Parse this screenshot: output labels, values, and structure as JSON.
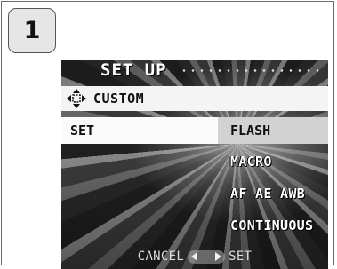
{
  "step": {
    "number": "1"
  },
  "screen": {
    "title": "SET UP",
    "custom_row": {
      "icon": "four-way-arrows-icon",
      "label": "CUSTOM"
    },
    "set_row": {
      "label": "SET",
      "selected_item": "FLASH"
    },
    "menu_items": [
      "MACRO",
      "AF AE AWB",
      "CONTINUOUS"
    ],
    "footer": {
      "cancel_label": "CANCEL",
      "set_label": "SET",
      "nav_icon": "left-right-arrows-icon"
    }
  },
  "colors": {
    "highlight": "#d2d2d2",
    "bar": "#f4f4f4",
    "text_dark": "#111111",
    "text_light": "#ffffff"
  }
}
